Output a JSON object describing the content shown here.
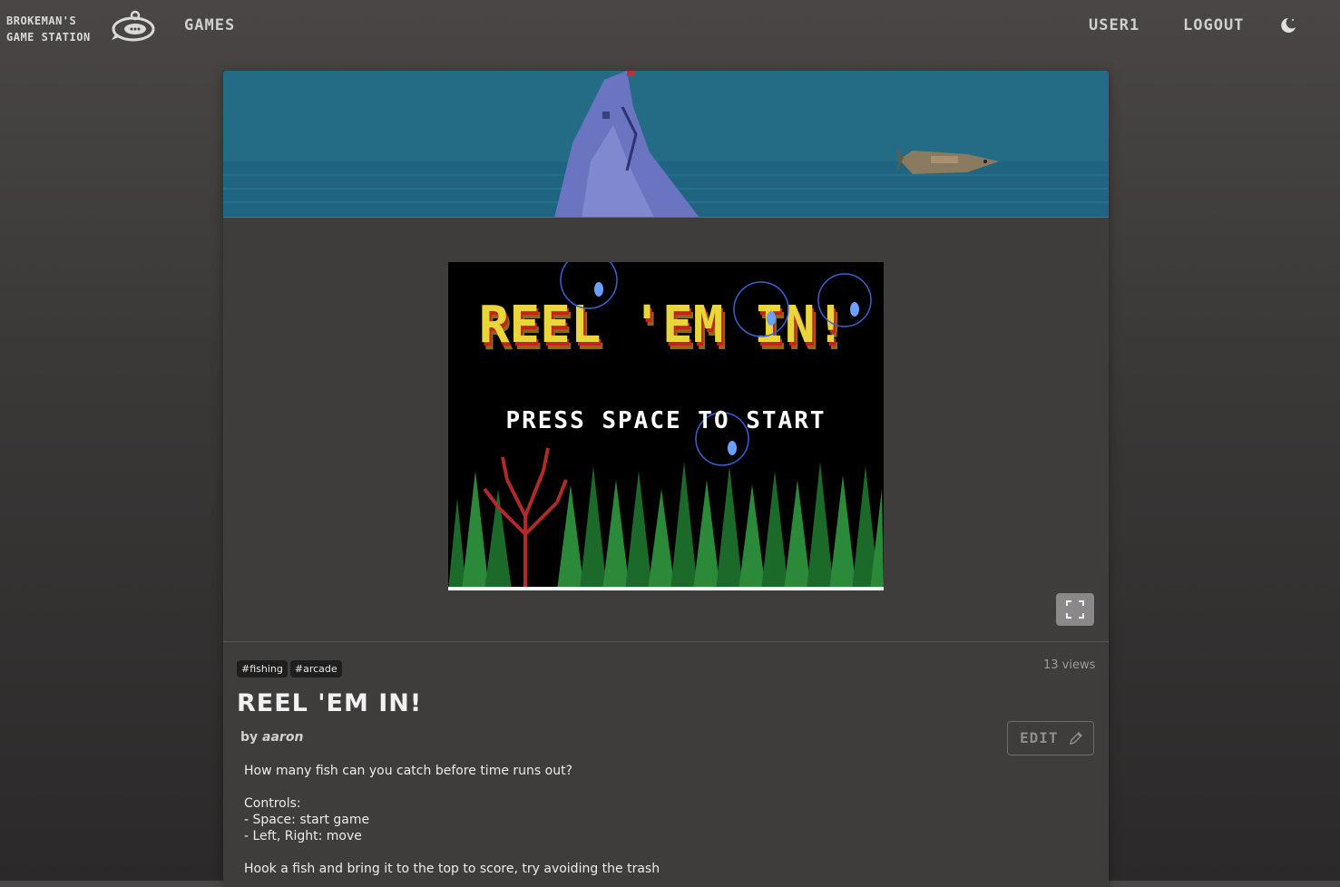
{
  "nav": {
    "brand_line1": "BROKEMAN'S",
    "brand_line2": "GAME STATION",
    "games_label": "GAMES",
    "user_label": "USER1",
    "logout_label": "LOGOUT",
    "theme_icon": "moon-icon"
  },
  "game": {
    "logo_text": "REEL 'EM IN!",
    "press_start": "PRESS SPACE TO START",
    "fullscreen_icon": "fullscreen-icon"
  },
  "details": {
    "tags": [
      "#fishing",
      "#arcade"
    ],
    "views": "13 views",
    "title": "REEL 'EM IN!",
    "by_prefix": "by",
    "author": "aaron",
    "edit_label": "EDIT",
    "edit_icon": "pencil-icon"
  },
  "description": {
    "line1": "How many fish can you catch before time runs out?",
    "line2": "Controls:",
    "line3": "- Space: start game",
    "line4": "- Left, Right: move",
    "line5": "Hook a fish and bring it to the top to score, try avoiding the trash"
  },
  "colors": {
    "background": "#3b3838",
    "card": "#3f3c3c",
    "banner_water": "#246c86",
    "title_yellow": "#e8d63a"
  }
}
